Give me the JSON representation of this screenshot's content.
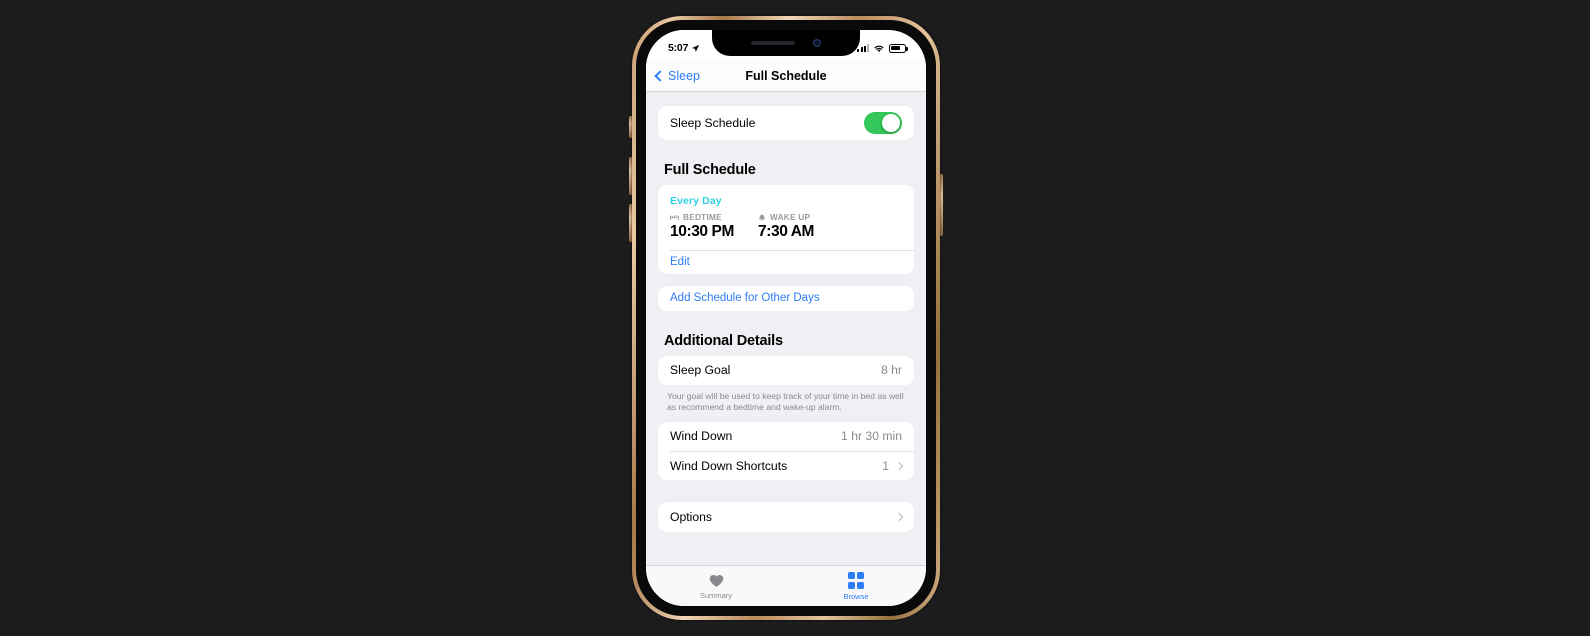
{
  "device": {
    "frame": "iphone-gold",
    "accent": "#2d7df6",
    "toggle_on_color": "#34c759",
    "schedule_day_color": "#2fd3e3"
  },
  "status_bar": {
    "time": "5:07",
    "location_icon": "location-arrow-icon",
    "signal_icon": "cellular-signal-icon",
    "wifi_icon": "wifi-icon",
    "battery_icon": "battery-icon"
  },
  "nav_bar": {
    "back_label": "Sleep",
    "back_icon": "chevron-left-icon",
    "title": "Full Schedule"
  },
  "sleep_schedule": {
    "label": "Sleep Schedule",
    "enabled": true
  },
  "full_schedule": {
    "section_title": "Full Schedule",
    "day_label": "Every Day",
    "bedtime": {
      "icon": "bed-icon",
      "caption": "BEDTIME",
      "time": "10:30 PM"
    },
    "wake_up": {
      "icon": "bell-icon",
      "caption": "WAKE UP",
      "time": "7:30 AM"
    },
    "edit_label": "Edit",
    "add_schedule_label": "Add Schedule for Other Days"
  },
  "additional_details": {
    "section_title": "Additional Details",
    "sleep_goal": {
      "label": "Sleep Goal",
      "value": "8 hr"
    },
    "sleep_goal_footnote": "Your goal will be used to keep track of your time in bed as well as recommend a bedtime and wake-up alarm.",
    "wind_down": {
      "label": "Wind Down",
      "value": "1 hr 30 min"
    },
    "wind_down_shortcuts": {
      "label": "Wind Down Shortcuts",
      "value": "1"
    },
    "options": {
      "label": "Options"
    }
  },
  "tab_bar": {
    "tabs": [
      {
        "label": "Summary",
        "icon": "heart-icon",
        "active": false
      },
      {
        "label": "Browse",
        "icon": "grid-icon",
        "active": true
      }
    ]
  }
}
